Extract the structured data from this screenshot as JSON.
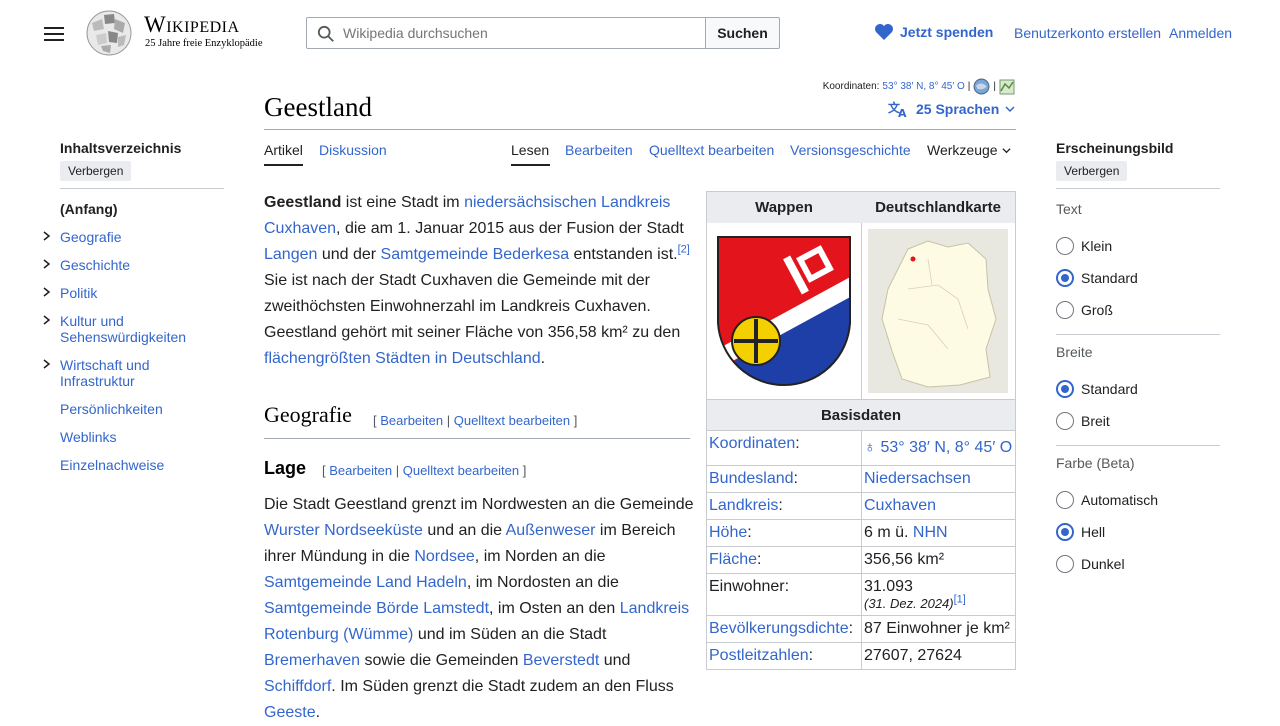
{
  "header": {
    "wordmark": "Wikipedia",
    "tagline": "25 Jahre freie Enzyklopädie",
    "search_placeholder": "Wikipedia durchsuchen",
    "search_button": "Suchen",
    "donate": "Jetzt spenden",
    "create_account": "Benutzerkonto erstellen",
    "login": "Anmelden"
  },
  "toc": {
    "title": "Inhaltsverzeichnis",
    "hide": "Verbergen",
    "items": [
      {
        "label": "(Anfang)"
      },
      {
        "label": "Geografie"
      },
      {
        "label": "Geschichte"
      },
      {
        "label": "Politik"
      },
      {
        "label": "Kultur und Sehenswürdigkeiten"
      },
      {
        "label": "Wirtschaft und Infrastruktur"
      },
      {
        "label": "Persönlichkeiten"
      },
      {
        "label": "Weblinks"
      },
      {
        "label": "Einzelnachweise"
      }
    ]
  },
  "article": {
    "coords_label": "Koordinaten:",
    "coords_value": "53° 38′ N, 8° 45′ O",
    "coords_sep": "|",
    "title": "Geestland",
    "languages": "25 Sprachen",
    "tabs": {
      "article": "Artikel",
      "discussion": "Diskussion",
      "read": "Lesen",
      "edit": "Bearbeiten",
      "edit_source": "Quelltext bearbeiten",
      "history": "Versionsgeschichte",
      "tools": "Werkzeuge"
    },
    "intro": {
      "p1_bold": "Geestland",
      "p1_a": " ist eine Stadt im ",
      "p1_link1": "niedersächsischen Landkreis Cuxhaven",
      "p1_b": ", die am 1. Januar 2015 aus der Fusion der Stadt ",
      "p1_link2": "Langen",
      "p1_c": " und der ",
      "p1_link3": "Samtgemeinde Bederkesa",
      "p1_d": " entstanden ist.",
      "p1_ref": "[2]",
      "p1_e": " Sie ist nach der Stadt Cuxhaven die Gemeinde mit der zweithöchsten Einwohnerzahl im Landkreis Cuxhaven. Geestland gehört mit seiner Fläche von 356,58 km² zu den ",
      "p1_link4": "flächengrößten Städten in Deutschland",
      "p1_f": "."
    },
    "h2": "Geografie",
    "h2_edit": "Bearbeiten",
    "h2_edit_source": "Quelltext bearbeiten",
    "h3": "Lage",
    "h3_edit": "Bearbeiten",
    "h3_edit_source": "Quelltext bearbeiten",
    "lage": {
      "a": "Die Stadt Geestland grenzt im Nordwesten an die Gemeinde ",
      "l1": "Wurster Nordseeküste",
      "b": " und an die ",
      "l2": "Außenweser",
      "c": " im Bereich ihrer Mündung in die ",
      "l3": "Nordsee",
      "d": ", im Norden an die ",
      "l4": "Samtgemeinde Land Hadeln",
      "e": ", im Nordosten an die ",
      "l5": "Samtgemeinde Börde Lamstedt",
      "f": ", im Osten an den ",
      "l6": "Landkreis Rotenburg (Wümme)",
      "g": " und im Süden an die Stadt ",
      "l7": "Bremerhaven",
      "h": " sowie die Gemeinden ",
      "l8": "Beverstedt",
      "i": " und ",
      "l9": "Schiffdorf",
      "j": ". Im Süden grenzt die Stadt zudem an den Fluss ",
      "l10": "Geeste",
      "k": "."
    }
  },
  "infobox": {
    "col1": "Wappen",
    "col2": "Deutschlandkarte",
    "section": "Basisdaten",
    "rows": [
      {
        "key": "Koordinaten",
        "value": "53° 38′ N, 8° 45′ O"
      },
      {
        "key": "Bundesland",
        "value": "Niedersachsen"
      },
      {
        "key": "Landkreis",
        "value": "Cuxhaven"
      },
      {
        "key": "Höhe",
        "value_prefix": "6 m ü. ",
        "value": "NHN"
      },
      {
        "key": "Fläche",
        "value": "356,56 km²"
      },
      {
        "key": "Einwohner",
        "value": "31.093",
        "note": "(31. Dez. 2024)",
        "ref": "[1]"
      },
      {
        "key": "Bevölkerungsdichte",
        "value": "87 Einwohner je km²"
      },
      {
        "key": "Postleitzahlen",
        "value": "27607, 27624"
      }
    ]
  },
  "appearance": {
    "title": "Erscheinungsbild",
    "hide": "Verbergen",
    "text_label": "Text",
    "text_options": [
      "Klein",
      "Standard",
      "Groß"
    ],
    "text_selected": "Standard",
    "width_label": "Breite",
    "width_options": [
      "Standard",
      "Breit"
    ],
    "width_selected": "Standard",
    "color_label": "Farbe (Beta)",
    "color_options": [
      "Automatisch",
      "Hell",
      "Dunkel"
    ],
    "color_selected": "Hell"
  },
  "colors": {
    "link": "#3366cc",
    "text": "#202122",
    "border": "#a2a9b1",
    "donate_heart": "#3366cc"
  },
  "icons": [
    "menu-icon",
    "search-icon",
    "heart-icon",
    "translate-icon",
    "chevron-down-icon",
    "chevron-right-icon",
    "globe-icon",
    "map-icon"
  ]
}
